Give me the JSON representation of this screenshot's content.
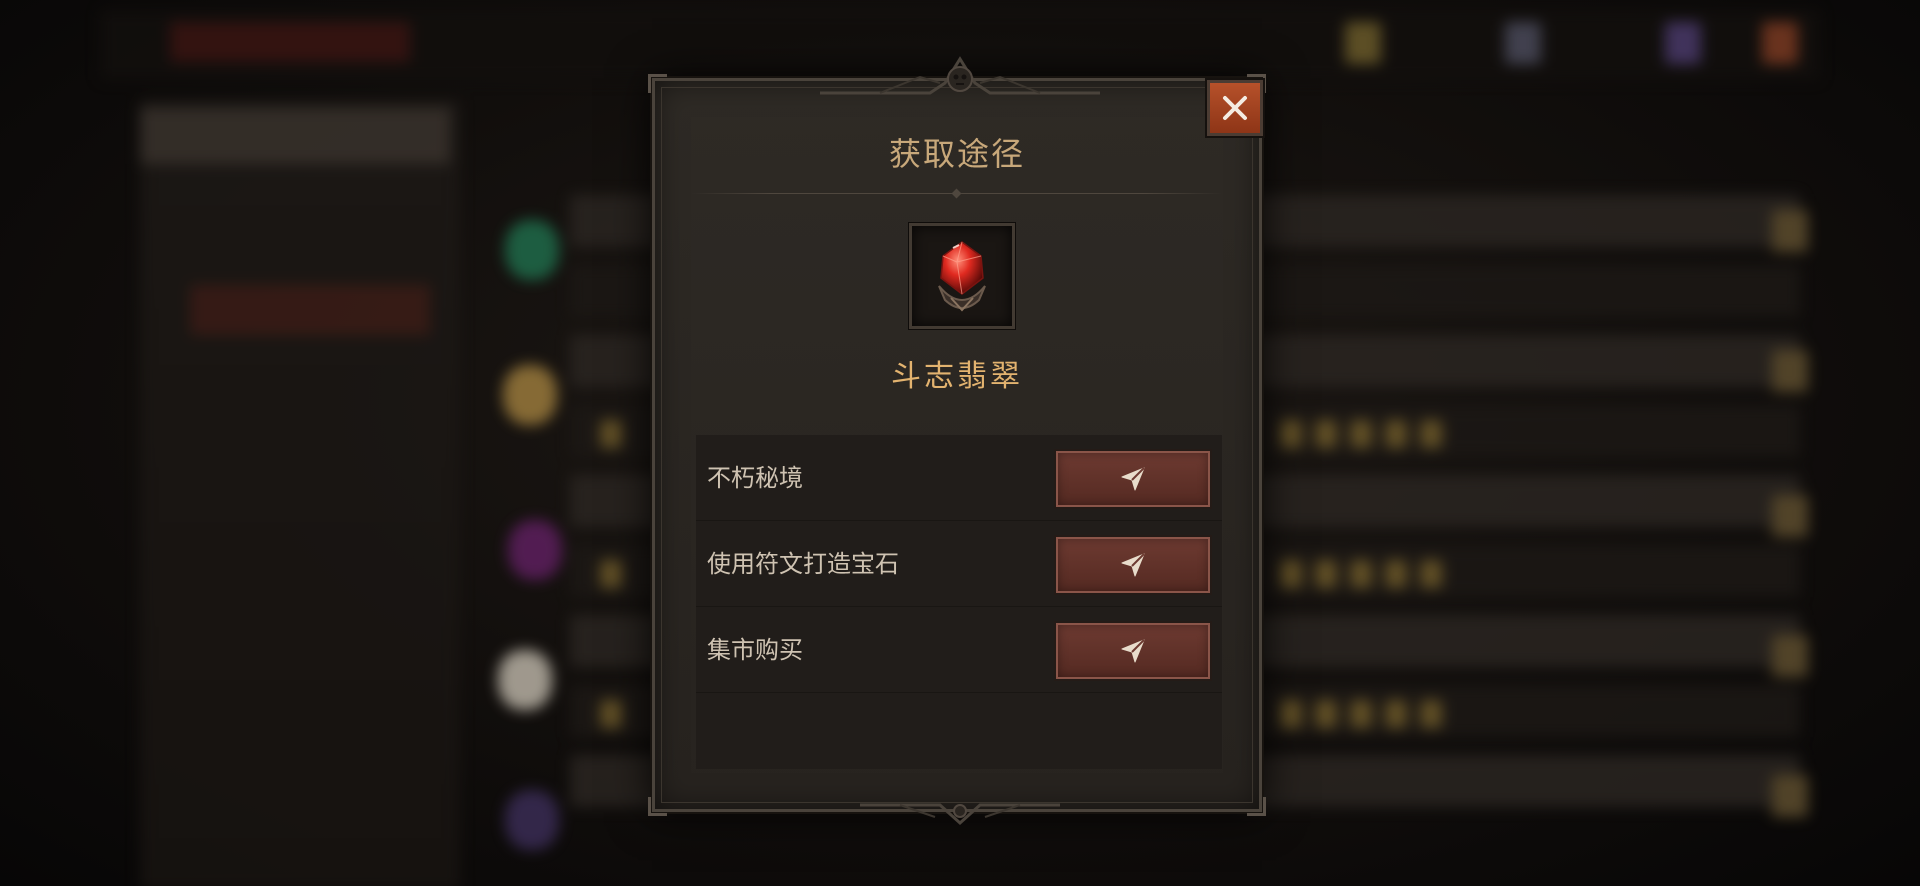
{
  "dialog": {
    "title": "获取途径",
    "close_icon": "close-icon",
    "item": {
      "name": "斗志翡翠",
      "icon": "red-gem-icon"
    },
    "sources": [
      {
        "label": "不朽秘境",
        "button_icon": "navigate-arrow-icon"
      },
      {
        "label": "使用符文打造宝石",
        "button_icon": "navigate-arrow-icon"
      },
      {
        "label": "集市购买",
        "button_icon": "navigate-arrow-icon"
      }
    ]
  },
  "colors": {
    "title": "#c8a87a",
    "item_name": "#e3b36f",
    "close_button": "#b6512a",
    "go_button": "#6d3a31"
  }
}
